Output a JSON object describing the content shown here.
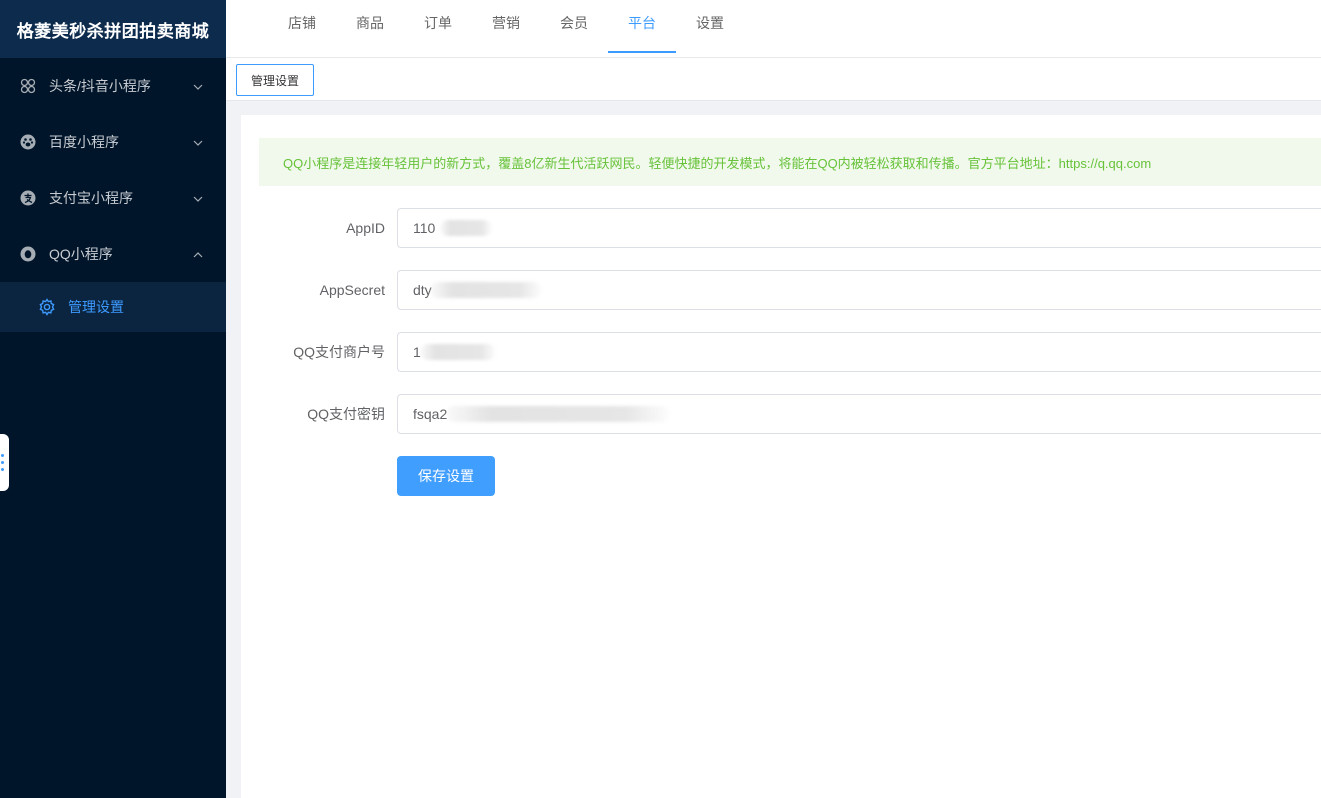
{
  "app": {
    "title": "格菱美秒杀拼团拍卖商城"
  },
  "sidebar": {
    "items": [
      {
        "label": "头条/抖音小程序",
        "icon": "grid-circles-icon",
        "expanded": false
      },
      {
        "label": "百度小程序",
        "icon": "paw-icon",
        "expanded": false
      },
      {
        "label": "支付宝小程序",
        "icon": "alipay-icon",
        "expanded": false
      },
      {
        "label": "QQ小程序",
        "icon": "qq-icon",
        "expanded": true
      }
    ],
    "sub_items": [
      {
        "label": "管理设置",
        "icon": "gear-icon",
        "active": true
      }
    ]
  },
  "topnav": {
    "tabs": [
      {
        "label": "店铺"
      },
      {
        "label": "商品"
      },
      {
        "label": "订单"
      },
      {
        "label": "营销"
      },
      {
        "label": "会员"
      },
      {
        "label": "平台"
      },
      {
        "label": "设置"
      }
    ],
    "active": "平台"
  },
  "subbar": {
    "tab_label": "管理设置"
  },
  "notice": {
    "text": "QQ小程序是连接年轻用户的新方式，覆盖8亿新生代活跃网民。轻便快捷的开发模式，将能在QQ内被轻松获取和传播。官方平台地址：https://q.qq.com"
  },
  "form": {
    "fields": [
      {
        "label": "AppID",
        "value": "110"
      },
      {
        "label": "AppSecret",
        "value": "dty"
      },
      {
        "label": "QQ支付商户号",
        "value": "1"
      },
      {
        "label": "QQ支付密钥",
        "value": "fsqa2"
      }
    ],
    "save_label": "保存设置"
  },
  "colors": {
    "sidebar_bg": "#001529",
    "brand_bg": "#0d2b4d",
    "accent": "#3d9bff",
    "notice_bg": "#f0f9eb",
    "notice_text": "#67c23a",
    "button": "#409eff"
  }
}
